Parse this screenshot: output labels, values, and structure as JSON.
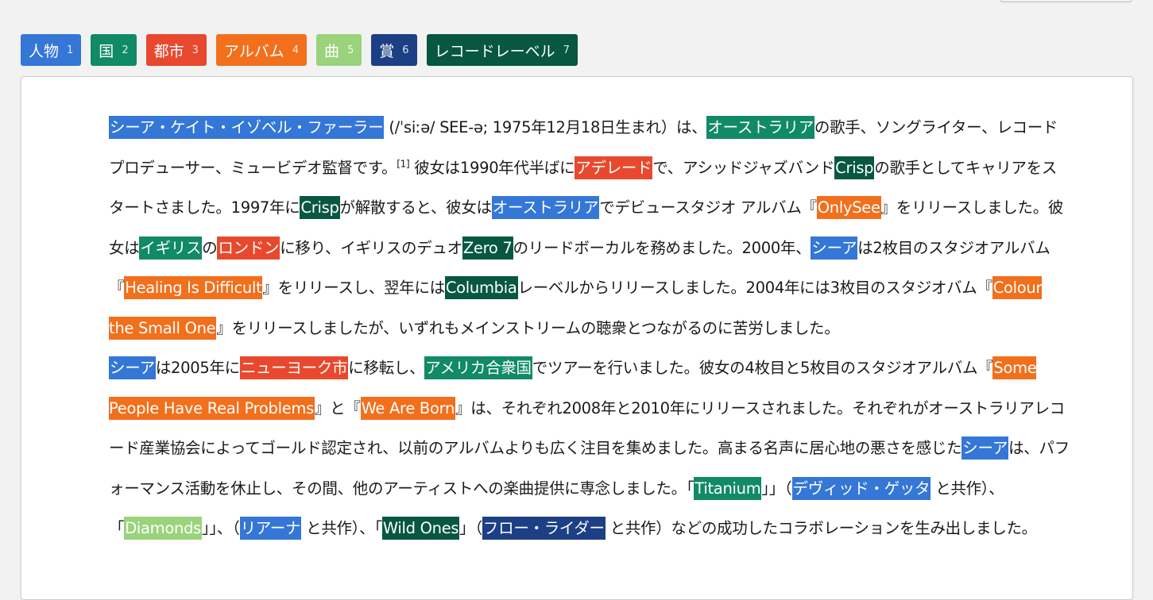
{
  "colors": {
    "person": "#3477d6",
    "country": "#118a66",
    "city": "#e8492e",
    "album": "#f26f1c",
    "song": "#9ad37c",
    "award": "#1c3f85",
    "label": "#075741"
  },
  "legend": [
    {
      "label": "人物",
      "key": "1",
      "type": "person"
    },
    {
      "label": "国",
      "key": "2",
      "type": "country"
    },
    {
      "label": "都市",
      "key": "3",
      "type": "city"
    },
    {
      "label": "アルバム",
      "key": "4",
      "type": "album"
    },
    {
      "label": "曲",
      "key": "5",
      "type": "song"
    },
    {
      "label": "賞",
      "key": "6",
      "type": "award"
    },
    {
      "label": "レコードレーベル",
      "key": "7",
      "type": "label"
    }
  ],
  "paragraphs": [
    [
      {
        "t": "シーア・ケイト・イゾベル・ファーラー",
        "e": "person"
      },
      {
        "t": " (/ˈsiːə/ SEE-ə; 1975年12月18日生まれ）は、"
      },
      {
        "t": "オーストラリア",
        "e": "country"
      },
      {
        "t": "の歌手、ソングライター、レコードプロデューサー、ミュービデオ監督です。"
      },
      {
        "t": "[1]",
        "sup": true
      },
      {
        "t": " 彼女は1990年代半ばに"
      },
      {
        "t": "アデレード",
        "e": "city"
      },
      {
        "t": "で、アシッドジャズバンド"
      },
      {
        "t": "Crisp",
        "e": "label"
      },
      {
        "t": "の歌手としてキャリアをスタートさました。1997年に"
      },
      {
        "t": "Crisp",
        "e": "label"
      },
      {
        "t": "が解散すると、彼女は"
      },
      {
        "t": "オーストラリア",
        "e": "person"
      },
      {
        "t": "でデビュースタジオ アルバム『"
      },
      {
        "t": "OnlySee",
        "e": "album"
      },
      {
        "t": "』をリリースしました。彼女は"
      },
      {
        "t": "イギリス",
        "e": "country"
      },
      {
        "t": "の"
      },
      {
        "t": "ロンドン",
        "e": "city"
      },
      {
        "t": "に移り、イギリスのデュオ"
      },
      {
        "t": "Zero 7",
        "e": "label"
      },
      {
        "t": "のリードボーカルを務めました。2000年、"
      },
      {
        "t": "シーア",
        "e": "person"
      },
      {
        "t": "は2枚目のスタジオアルバム『"
      },
      {
        "t": "Healing Is Difficult",
        "e": "album"
      },
      {
        "t": "』をリリースし、翌年には"
      },
      {
        "t": "Columbia",
        "e": "label"
      },
      {
        "t": "レーベルからリリースしました。2004年には3枚目のスタジオバム『"
      },
      {
        "t": "Colour the Small One",
        "e": "album"
      },
      {
        "t": "』をリリースしましたが、いずれもメインストリームの聴衆とつながるのに苦労しました。"
      }
    ],
    [
      {
        "t": "シーア",
        "e": "person"
      },
      {
        "t": "は2005年に"
      },
      {
        "t": "ニューヨーク市",
        "e": "city"
      },
      {
        "t": "に移転し、"
      },
      {
        "t": "アメリカ合衆国",
        "e": "country"
      },
      {
        "t": "でツアーを行いました。彼女の4枚目と5枚目のスタジオアルバム『"
      },
      {
        "t": "Some People Have Real Problems",
        "e": "album"
      },
      {
        "t": "』と『"
      },
      {
        "t": "We Are Born",
        "e": "album"
      },
      {
        "t": "』は、それぞれ2008年と2010年にリリースされました。それぞれがオーストラリアレコード産業協会によってゴールド認定され、以前のアルバムよりも広く注目を集めました。高まる名声に居心地の悪さを感じた"
      },
      {
        "t": "シーア",
        "e": "person"
      },
      {
        "t": "は、パフォーマンス活動を休止し、その間、他のアーティストへの楽曲提供に専念しました。「"
      },
      {
        "t": "Titanium",
        "e": "country"
      },
      {
        "t": "」」（"
      },
      {
        "t": "デヴィッド・ゲッタ",
        "e": "person"
      },
      {
        "t": " と共作）、「"
      },
      {
        "t": "Diamonds",
        "e": "song"
      },
      {
        "t": "」」、（"
      },
      {
        "t": "リアーナ",
        "e": "person"
      },
      {
        "t": " と共作）、「"
      },
      {
        "t": "Wild Ones",
        "e": "label"
      },
      {
        "t": "」（"
      },
      {
        "t": "フロー・ライダー",
        "e": "award"
      },
      {
        "t": " と共作）などの成功したコラボレーションを生み出しました。"
      }
    ]
  ]
}
